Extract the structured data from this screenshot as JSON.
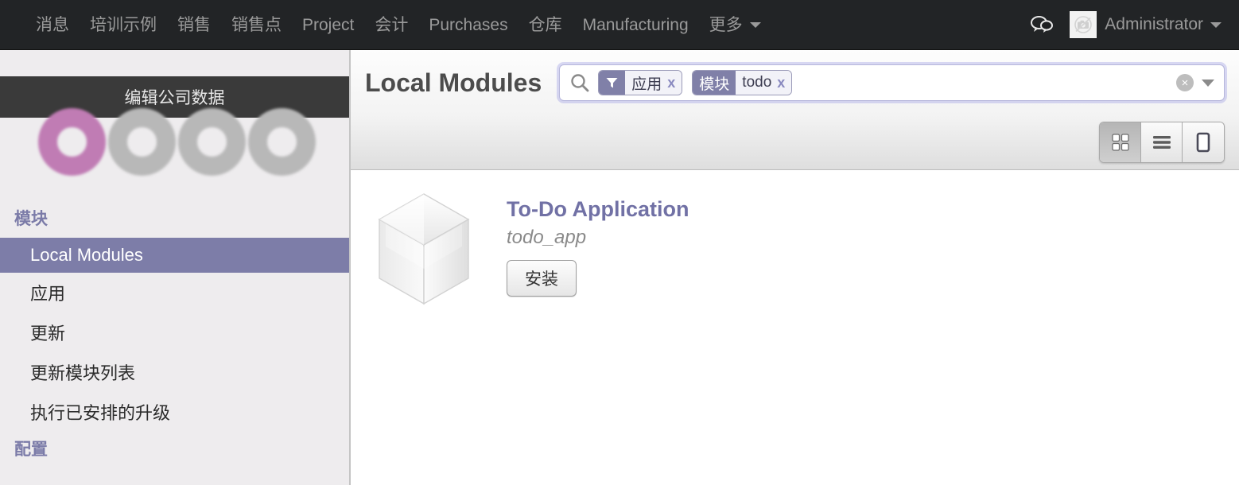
{
  "navbar": {
    "menu_items": [
      {
        "label": "消息",
        "name": "nav-messaging"
      },
      {
        "label": "培训示例",
        "name": "nav-training-example"
      },
      {
        "label": "销售",
        "name": "nav-sales"
      },
      {
        "label": "销售点",
        "name": "nav-point-of-sale"
      },
      {
        "label": "Project",
        "name": "nav-project"
      },
      {
        "label": "会计",
        "name": "nav-accounting"
      },
      {
        "label": "Purchases",
        "name": "nav-purchases"
      },
      {
        "label": "仓库",
        "name": "nav-warehouse"
      },
      {
        "label": "Manufacturing",
        "name": "nav-manufacturing"
      },
      {
        "label": "更多",
        "name": "nav-more",
        "caret": true
      }
    ],
    "chat_icon": "chat-bubbles-icon",
    "avatar_icon": "no-photo-camera-icon",
    "user_name": "Administrator",
    "background_color": "#222426",
    "text_color": "#9a9a9a"
  },
  "sidebar": {
    "company_bar_label": "编辑公司数据",
    "logo": {
      "name": "odoo-logo",
      "ring_colors": [
        "#c07cb4",
        "#b8b8b8",
        "#b8b8b8",
        "#b8b8b8"
      ]
    },
    "sections": [
      {
        "title": "模块",
        "items": [
          {
            "label": "Local Modules",
            "active": true
          },
          {
            "label": "应用",
            "active": false
          },
          {
            "label": "更新",
            "active": false
          },
          {
            "label": "更新模块列表",
            "active": false
          },
          {
            "label": "执行已安排的升级",
            "active": false
          }
        ]
      },
      {
        "title": "配置",
        "items": []
      }
    ],
    "active_color": "#7d7da8",
    "section_color": "#7b7ba8"
  },
  "control_panel": {
    "page_title": "Local Modules",
    "search": {
      "search_icon": "magnifier-icon",
      "placeholder": "",
      "value": "",
      "clear_label": "×",
      "facets": [
        {
          "category_icon": "filter-funnel-icon",
          "category_label": "",
          "value": "应用",
          "remove_label": "x",
          "name": "facet-apps"
        },
        {
          "category_icon": "",
          "category_label": "模块",
          "value": "todo",
          "remove_label": "x",
          "name": "facet-module-todo"
        }
      ]
    },
    "views": [
      {
        "name": "view-kanban",
        "icon": "grid-icon",
        "active": true
      },
      {
        "name": "view-list",
        "icon": "list-icon",
        "active": false
      },
      {
        "name": "view-form",
        "icon": "form-icon",
        "active": false
      }
    ]
  },
  "kanban": {
    "modules": [
      {
        "icon": "module-cube-icon",
        "title": "To-Do Application",
        "technical_name": "todo_app",
        "install_label": "安装"
      }
    ]
  },
  "colors": {
    "accent_purple": "#7d7da8",
    "title_purple": "#7171a5",
    "navbar_dark": "#222426",
    "company_bar_dark": "#3a3a3a",
    "sidebar_bg": "#eeecee"
  }
}
